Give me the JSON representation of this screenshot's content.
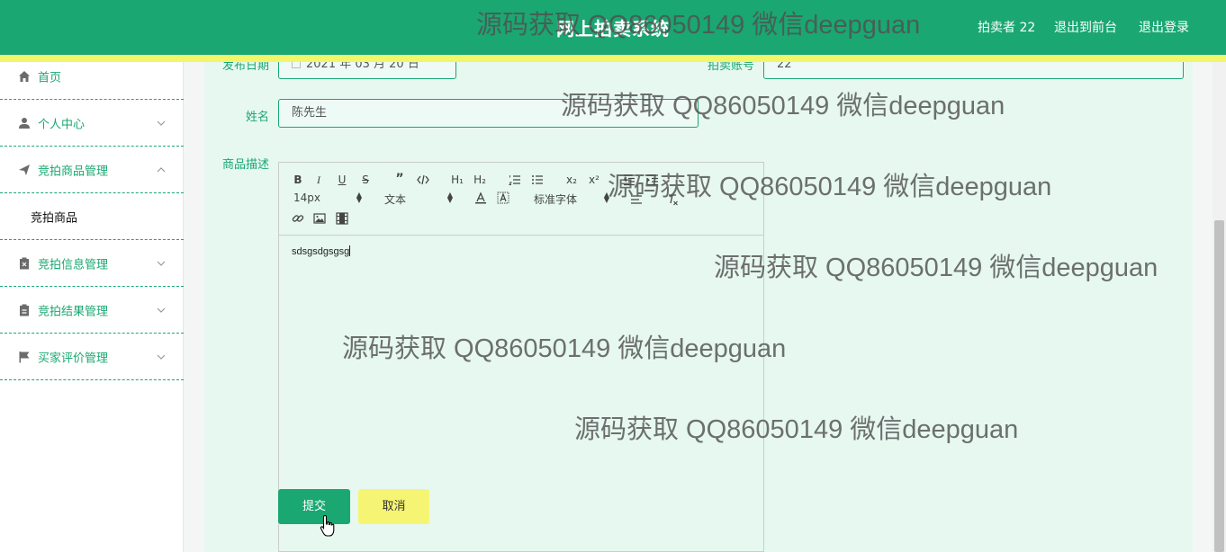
{
  "header": {
    "title": "网上拍卖系统",
    "user_label": "拍卖者 22",
    "front_label": "退出到前台",
    "logout_label": "退出登录"
  },
  "sidebar": {
    "items": [
      {
        "label": "首页",
        "icon": "home-icon"
      },
      {
        "label": "个人中心",
        "icon": "user-icon"
      },
      {
        "label": "竞拍商品管理",
        "icon": "send-icon"
      },
      {
        "label": "竞拍商品"
      },
      {
        "label": "竞拍信息管理",
        "icon": "clipboard-x-icon"
      },
      {
        "label": "竞拍结果管理",
        "icon": "clipboard-icon"
      },
      {
        "label": "买家评价管理",
        "icon": "flag-icon"
      }
    ]
  },
  "form": {
    "date_label": "发布日期",
    "date_value": "2021 年 03 月 20 日",
    "account_label": "拍卖账号",
    "account_value": "22",
    "name_label": "姓名",
    "name_value": "陈先生",
    "desc_label": "商品描述"
  },
  "editor": {
    "font_size": "14px",
    "format": "文本",
    "font_family": "标准字体",
    "content": "sdsgsdgsgsg",
    "toolbar": {
      "h1": "H₁",
      "h2": "H₂",
      "sub": "x₂",
      "sup": "x²"
    }
  },
  "buttons": {
    "submit": "提交",
    "cancel": "取消"
  },
  "watermark": "源码获取 QQ86050149 微信deepguan",
  "colors": {
    "primary": "#1aa772",
    "accent_yellow": "#f6f573",
    "main_bg": "#e6f8f0"
  }
}
